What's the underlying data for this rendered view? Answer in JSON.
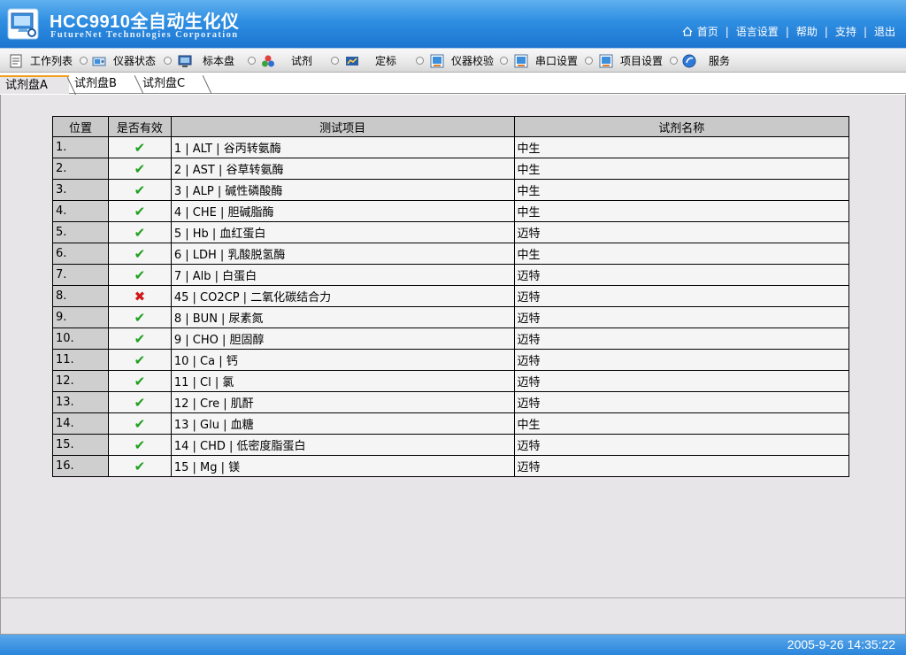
{
  "header": {
    "title": "HCC9910全自动生化仪",
    "subtitle": "FutureNet Technologies Corporation",
    "links": [
      "首页",
      "语言设置",
      "帮助",
      "支持",
      "退出"
    ]
  },
  "toolbar": {
    "items": [
      {
        "label": "工作列表",
        "icon": "worklist-icon"
      },
      {
        "label": "仪器状态",
        "icon": "instrument-status-icon"
      },
      {
        "label": "标本盘",
        "icon": "sample-tray-icon"
      },
      {
        "label": "试剂",
        "icon": "reagent-icon"
      },
      {
        "label": "定标",
        "icon": "calibration-icon"
      },
      {
        "label": "仪器校验",
        "icon": "instrument-check-icon"
      },
      {
        "label": "串口设置",
        "icon": "serial-port-icon"
      },
      {
        "label": "项目设置",
        "icon": "item-settings-icon"
      },
      {
        "label": "服务",
        "icon": "service-icon"
      }
    ]
  },
  "tabs": [
    {
      "label": "试剂盘A",
      "active": true
    },
    {
      "label": "试剂盘B",
      "active": false
    },
    {
      "label": "试剂盘C",
      "active": false
    }
  ],
  "table": {
    "headers": [
      "位置",
      "是否有效",
      "测试项目",
      "试剂名称"
    ],
    "rows": [
      {
        "pos": "1.",
        "valid": true,
        "item": "1 | ALT | 谷丙转氨酶",
        "reagent": "中生"
      },
      {
        "pos": "2.",
        "valid": true,
        "item": "2 | AST | 谷草转氨酶",
        "reagent": "中生"
      },
      {
        "pos": "3.",
        "valid": true,
        "item": "3 | ALP | 碱性磷酸酶",
        "reagent": "中生"
      },
      {
        "pos": "4.",
        "valid": true,
        "item": "4 | CHE | 胆碱脂酶",
        "reagent": "中生"
      },
      {
        "pos": "5.",
        "valid": true,
        "item": "5 | Hb | 血红蛋白",
        "reagent": "迈特"
      },
      {
        "pos": "6.",
        "valid": true,
        "item": "6 | LDH | 乳酸脱氢酶",
        "reagent": "中生"
      },
      {
        "pos": "7.",
        "valid": true,
        "item": "7 | Alb | 白蛋白",
        "reagent": "迈特"
      },
      {
        "pos": "8.",
        "valid": false,
        "item": "45 | CO2CP | 二氧化碳结合力",
        "reagent": "迈特"
      },
      {
        "pos": "9.",
        "valid": true,
        "item": "8 | BUN | 尿素氮",
        "reagent": "迈特"
      },
      {
        "pos": "10.",
        "valid": true,
        "item": "9 | CHO | 胆固醇",
        "reagent": "迈特"
      },
      {
        "pos": "11.",
        "valid": true,
        "item": "10 | Ca | 钙",
        "reagent": "迈特"
      },
      {
        "pos": "12.",
        "valid": true,
        "item": "11 | Cl | 氯",
        "reagent": "迈特"
      },
      {
        "pos": "13.",
        "valid": true,
        "item": "12 | Cre | 肌酐",
        "reagent": "迈特"
      },
      {
        "pos": "14.",
        "valid": true,
        "item": "13 | Glu | 血糖",
        "reagent": "中生"
      },
      {
        "pos": "15.",
        "valid": true,
        "item": "14 | CHD | 低密度脂蛋白",
        "reagent": "迈特"
      },
      {
        "pos": "16.",
        "valid": true,
        "item": "15 | Mg | 镁",
        "reagent": "迈特"
      }
    ]
  },
  "status": {
    "datetime": "2005-9-26 14:35:22"
  },
  "colors": {
    "header_blue": "#2f8ee2",
    "valid_green": "#1fa01f",
    "invalid_red": "#d01818",
    "tab_accent": "#f0a020"
  }
}
